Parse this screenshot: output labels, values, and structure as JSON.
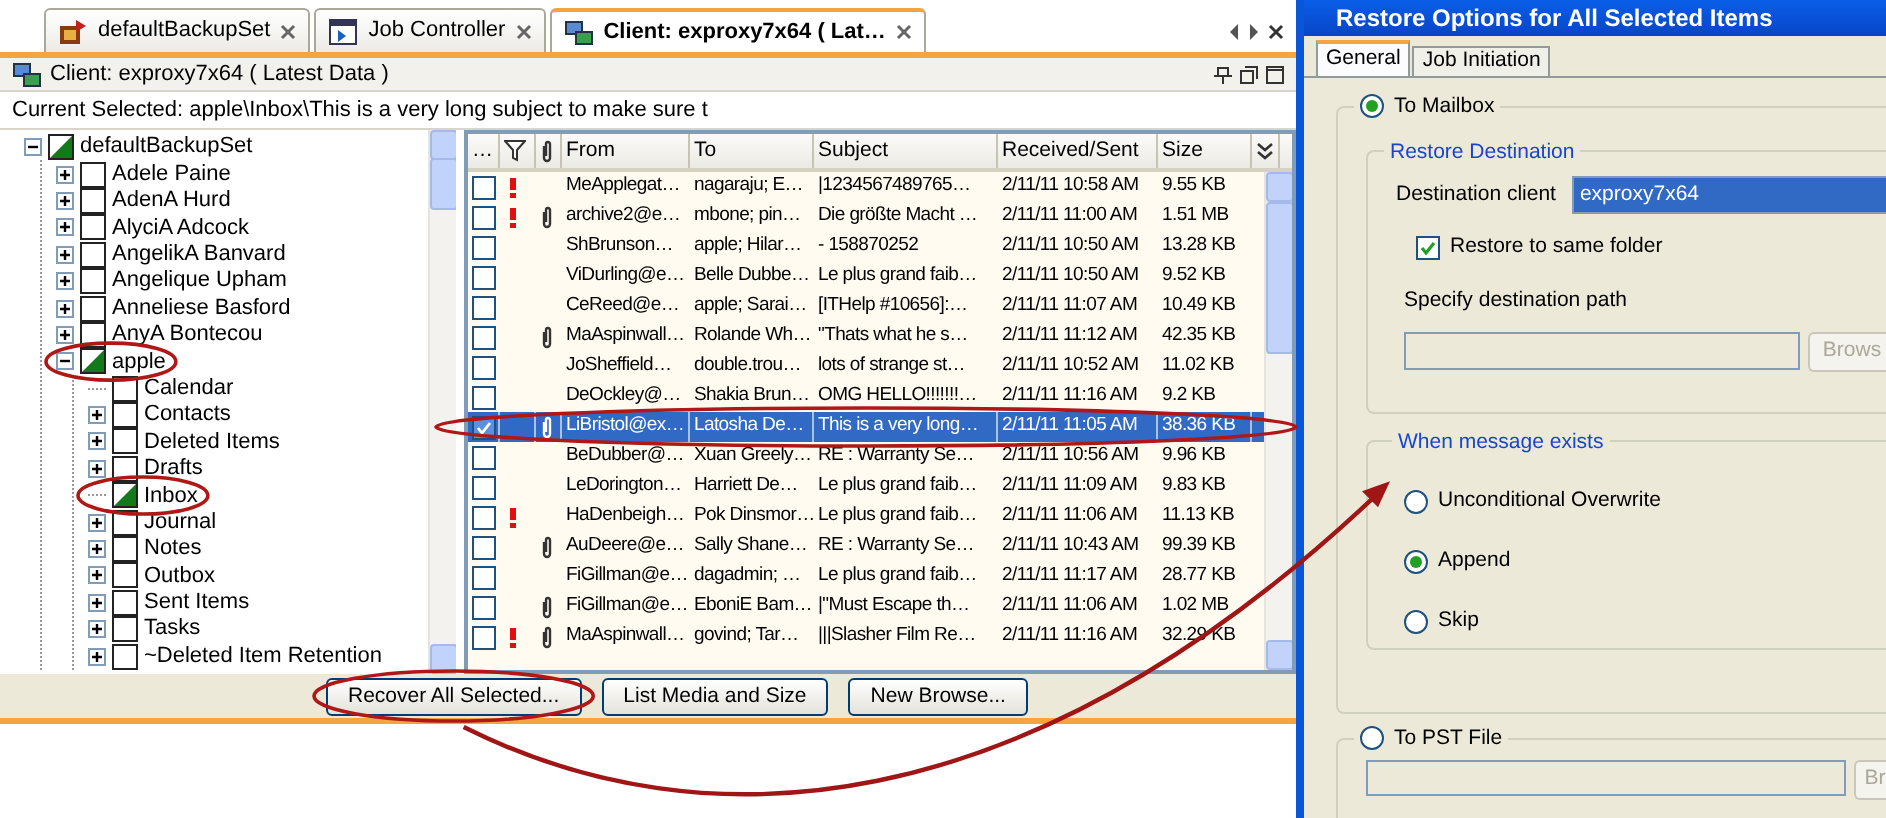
{
  "app_tabs": [
    {
      "label": "defaultBackupSet",
      "selected": false
    },
    {
      "label": "Job Controller",
      "selected": false
    },
    {
      "label": "Client: exproxy7x64 ( Lat…",
      "selected": true
    }
  ],
  "client_header": {
    "title": "Client: exproxy7x64 ( Latest Data )"
  },
  "current_selected": "Current Selected: apple\\Inbox\\This is a very long subject to make sure t",
  "tree": [
    {
      "label": "defaultBackupSet",
      "partial": true,
      "expandable": true,
      "expanded": true,
      "circled": false,
      "children": [
        {
          "label": "Adele Paine",
          "partial": false,
          "expandable": true,
          "expanded": false,
          "circled": false
        },
        {
          "label": "AdenA Hurd",
          "partial": false,
          "expandable": true,
          "expanded": false,
          "circled": false
        },
        {
          "label": "AlyciA Adcock",
          "partial": false,
          "expandable": true,
          "expanded": false,
          "circled": false
        },
        {
          "label": "AngelikA Banvard",
          "partial": false,
          "expandable": true,
          "expanded": false,
          "circled": false
        },
        {
          "label": "Angelique Upham",
          "partial": false,
          "expandable": true,
          "expanded": false,
          "circled": false
        },
        {
          "label": "Anneliese Basford",
          "partial": false,
          "expandable": true,
          "expanded": false,
          "circled": false
        },
        {
          "label": "AnyA Bontecou",
          "partial": false,
          "expandable": true,
          "expanded": false,
          "circled": false
        },
        {
          "label": "apple",
          "partial": true,
          "expandable": true,
          "expanded": true,
          "circled": true,
          "children": [
            {
              "label": "Calendar",
              "partial": false,
              "expandable": false,
              "circled": false
            },
            {
              "label": "Contacts",
              "partial": false,
              "expandable": true,
              "expanded": false,
              "circled": false
            },
            {
              "label": "Deleted Items",
              "partial": false,
              "expandable": true,
              "expanded": false,
              "circled": false
            },
            {
              "label": "Drafts",
              "partial": false,
              "expandable": true,
              "expanded": false,
              "circled": false
            },
            {
              "label": "Inbox",
              "partial": true,
              "expandable": false,
              "circled": true
            },
            {
              "label": "Journal",
              "partial": false,
              "expandable": true,
              "expanded": false,
              "circled": false
            },
            {
              "label": "Notes",
              "partial": false,
              "expandable": true,
              "expanded": false,
              "circled": false
            },
            {
              "label": "Outbox",
              "partial": false,
              "expandable": true,
              "expanded": false,
              "circled": false
            },
            {
              "label": "Sent Items",
              "partial": false,
              "expandable": true,
              "expanded": false,
              "circled": false
            },
            {
              "label": "Tasks",
              "partial": false,
              "expandable": true,
              "expanded": false,
              "circled": false
            },
            {
              "label": "~Deleted Item Retention",
              "partial": false,
              "expandable": true,
              "expanded": false,
              "circled": false
            }
          ]
        }
      ]
    }
  ],
  "message_table": {
    "columns": [
      {
        "kind": "text",
        "label": "…"
      },
      {
        "kind": "filter"
      },
      {
        "kind": "attachment"
      },
      {
        "kind": "text",
        "label": "From"
      },
      {
        "kind": "text",
        "label": "To"
      },
      {
        "kind": "text",
        "label": "Subject"
      },
      {
        "kind": "text",
        "label": "Received/Sent"
      },
      {
        "kind": "text",
        "label": "Size"
      }
    ],
    "rows": [
      {
        "checked": false,
        "important": true,
        "attachment": false,
        "from": "MeApplegat…",
        "to": "nagaraju; E…",
        "subject": "|1234567489765…",
        "received": "2/11/11 10:58 AM",
        "size": "9.55 KB",
        "selected": false,
        "circled": false
      },
      {
        "checked": false,
        "important": true,
        "attachment": true,
        "from": "archive2@e…",
        "to": "mbone; pin…",
        "subject": "Die größte Macht …",
        "received": "2/11/11 11:00 AM",
        "size": "1.51 MB",
        "selected": false,
        "circled": false
      },
      {
        "checked": false,
        "important": false,
        "attachment": false,
        "from": "ShBrunson…",
        "to": "apple; Hilar…",
        "subject": "- 158870252",
        "received": "2/11/11 10:50 AM",
        "size": "13.28 KB",
        "selected": false,
        "circled": false
      },
      {
        "checked": false,
        "important": false,
        "attachment": false,
        "from": "ViDurling@e…",
        "to": "Belle Dubbe…",
        "subject": "Le plus grand faib…",
        "received": "2/11/11 10:50 AM",
        "size": "9.52 KB",
        "selected": false,
        "circled": false
      },
      {
        "checked": false,
        "important": false,
        "attachment": false,
        "from": "CeReed@e…",
        "to": "apple; Sarai…",
        "subject": "[ITHelp #10656]:…",
        "received": "2/11/11 11:07 AM",
        "size": "10.49 KB",
        "selected": false,
        "circled": false
      },
      {
        "checked": false,
        "important": false,
        "attachment": true,
        "from": "MaAspinwall…",
        "to": "Rolande Wh…",
        "subject": "\"Thats what he s…",
        "received": "2/11/11 11:12 AM",
        "size": "42.35 KB",
        "selected": false,
        "circled": false
      },
      {
        "checked": false,
        "important": false,
        "attachment": false,
        "from": "JoSheffield…",
        "to": "double.trou…",
        "subject": "lots of strange st…",
        "received": "2/11/11 10:52 AM",
        "size": "11.02 KB",
        "selected": false,
        "circled": false
      },
      {
        "checked": false,
        "important": false,
        "attachment": false,
        "from": "DeOckley@…",
        "to": "Shakia Brun…",
        "subject": "OMG HELLO!!!!!!!…",
        "received": "2/11/11 11:16 AM",
        "size": "9.2 KB",
        "selected": false,
        "circled": false
      },
      {
        "checked": true,
        "important": false,
        "attachment": true,
        "from": "LiBristol@ex…",
        "to": "Latosha De…",
        "subject": "This is a very long…",
        "received": "2/11/11 11:05 AM",
        "size": "38.36 KB",
        "selected": true,
        "circled": true
      },
      {
        "checked": false,
        "important": false,
        "attachment": false,
        "from": "BeDubber@…",
        "to": "Xuan Greely…",
        "subject": "RE : Warranty Se…",
        "received": "2/11/11 10:56 AM",
        "size": "9.96 KB",
        "selected": false,
        "circled": false
      },
      {
        "checked": false,
        "important": false,
        "attachment": false,
        "from": "LeDorington…",
        "to": "Harriett De…",
        "subject": "Le plus grand faib…",
        "received": "2/11/11 11:09 AM",
        "size": "9.83 KB",
        "selected": false,
        "circled": false
      },
      {
        "checked": false,
        "important": true,
        "attachment": false,
        "from": "HaDenbeigh…",
        "to": "Pok Dinsmor…",
        "subject": "Le plus grand faib…",
        "received": "2/11/11 11:06 AM",
        "size": "11.13 KB",
        "selected": false,
        "circled": false
      },
      {
        "checked": false,
        "important": false,
        "attachment": true,
        "from": "AuDeere@e…",
        "to": "Sally Shane…",
        "subject": "RE : Warranty Se…",
        "received": "2/11/11 10:43 AM",
        "size": "99.39 KB",
        "selected": false,
        "circled": false
      },
      {
        "checked": false,
        "important": false,
        "attachment": false,
        "from": "FiGillman@e…",
        "to": "dagadmin; …",
        "subject": "Le plus grand faib…",
        "received": "2/11/11 11:17 AM",
        "size": "28.77 KB",
        "selected": false,
        "circled": false
      },
      {
        "checked": false,
        "important": false,
        "attachment": true,
        "from": "FiGillman@e…",
        "to": "EboniE Bam…",
        "subject": "|\"Must Escape th…",
        "received": "2/11/11 11:06 AM",
        "size": "1.02 MB",
        "selected": false,
        "circled": false
      },
      {
        "checked": false,
        "important": true,
        "attachment": true,
        "from": "MaAspinwall…",
        "to": "govind; Tar…",
        "subject": "|||Slasher Film Re…",
        "received": "2/11/11 11:16 AM",
        "size": "32.29 KB",
        "selected": false,
        "circled": false
      }
    ]
  },
  "buttons": [
    {
      "label": "Recover All Selected...",
      "circled": true
    },
    {
      "label": "List Media and Size",
      "circled": false
    },
    {
      "label": "New Browse...",
      "circled": false
    }
  ],
  "dialog": {
    "title": "Restore Options for All Selected Items",
    "tabs": [
      {
        "label": "General",
        "selected": true
      },
      {
        "label": "Job Initiation",
        "selected": false
      }
    ],
    "to_mailbox": {
      "label": "To Mailbox",
      "selected": true
    },
    "restore_destination": {
      "legend": "Restore Destination",
      "client_label": "Destination client",
      "client_value": "exproxy7x64",
      "same_folder": {
        "label": "Restore to same folder",
        "checked": true
      },
      "path_label": "Specify destination path",
      "path_field": {
        "disabled": true
      },
      "browse": {
        "label": "Brows",
        "disabled": true
      }
    },
    "message_exists": {
      "legend": "When message exists",
      "options": [
        {
          "label": "Unconditional Overwrite",
          "selected": false
        },
        {
          "label": "Append",
          "selected": true
        },
        {
          "label": "Skip",
          "selected": false
        }
      ]
    },
    "to_pst": {
      "label": "To PST File",
      "selected": false,
      "path_field": {
        "disabled": true
      },
      "browse": {
        "label": "Br",
        "disabled": true
      }
    }
  }
}
